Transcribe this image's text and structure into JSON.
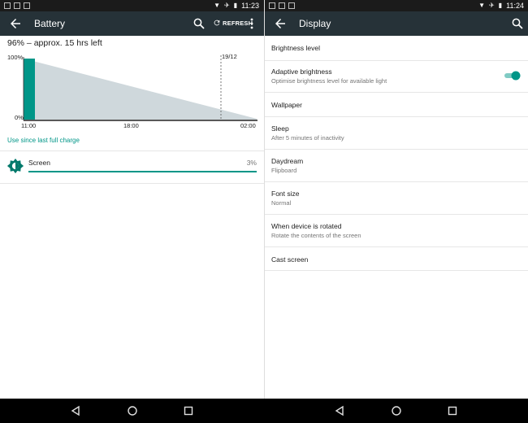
{
  "battery_screen": {
    "status": {
      "time": "11:23"
    },
    "toolbar": {
      "title": "Battery",
      "refresh_label": "REFRESH"
    },
    "summary": "96% – approx. 15 hrs left",
    "chart_data": {
      "type": "area",
      "y_labels": [
        "100%",
        "0%"
      ],
      "x_labels": [
        "11:00",
        "18:00",
        "02:00"
      ],
      "marker_label": "19/12",
      "charge_start_level": 100,
      "charge_current_level": 96,
      "projected_end_level": 0
    },
    "link": "Use since last full charge",
    "usage": [
      {
        "name": "Screen",
        "percent": "3%",
        "level": 1.0
      }
    ]
  },
  "display_screen": {
    "status": {
      "time": "11:24"
    },
    "toolbar": {
      "title": "Display"
    },
    "settings": [
      {
        "title": "Brightness level",
        "subtitle": ""
      },
      {
        "title": "Adaptive brightness",
        "subtitle": "Optimise brightness level for available light",
        "toggle": "on"
      },
      {
        "title": "Wallpaper",
        "subtitle": ""
      },
      {
        "title": "Sleep",
        "subtitle": "After 5 minutes of inactivity"
      },
      {
        "title": "Daydream",
        "subtitle": "Flipboard"
      },
      {
        "title": "Font size",
        "subtitle": "Normal"
      },
      {
        "title": "When device is rotated",
        "subtitle": "Rotate the contents of the screen"
      },
      {
        "title": "Cast screen",
        "subtitle": ""
      }
    ]
  },
  "colors": {
    "accent": "#009688",
    "toolbar": "#263238",
    "statusbar": "#1b1b1b",
    "chart_fill": "#cfd8dc"
  },
  "icons": [
    "back-arrow-icon",
    "search-icon",
    "refresh-icon",
    "more-vert-icon",
    "brightness-icon",
    "wifi-icon",
    "airplane-icon",
    "battery-icon",
    "nav-back-icon",
    "nav-home-icon",
    "nav-recents-icon"
  ]
}
